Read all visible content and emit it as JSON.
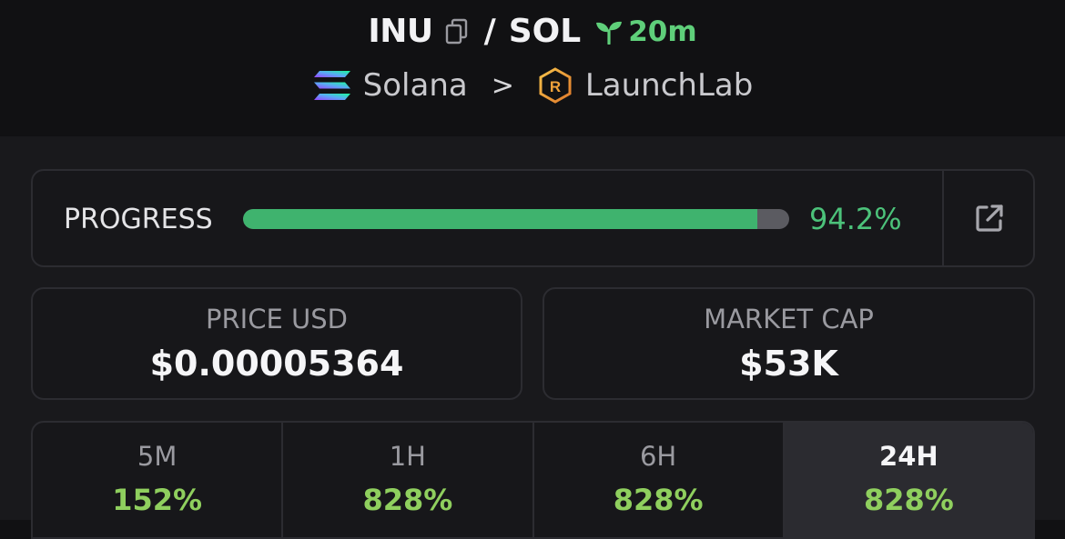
{
  "pair": {
    "base": "INU",
    "separator": "/",
    "quote": "SOL",
    "age": "20m"
  },
  "chain": {
    "network": "Solana",
    "chevron": ">",
    "dex": "LaunchLab"
  },
  "progress": {
    "label": "PROGRESS",
    "value_text": "94.2%",
    "fraction": 0.942
  },
  "stats": {
    "price": {
      "label": "PRICE USD",
      "value": "$0.00005364"
    },
    "market_cap": {
      "label": "MARKET CAP",
      "value": "$53K"
    }
  },
  "timeframes": [
    {
      "label": "5M",
      "value": "152%"
    },
    {
      "label": "1H",
      "value": "828%"
    },
    {
      "label": "6H",
      "value": "828%"
    },
    {
      "label": "24H",
      "value": "828%",
      "active": true
    }
  ],
  "colors": {
    "positive": "#8fcf5e",
    "progress_fill": "#3fb36e",
    "age": "#5fcf7a"
  },
  "icons": [
    "copy-icon",
    "sprout-icon",
    "solana-logo",
    "launchlab-logo",
    "external-link-icon"
  ]
}
